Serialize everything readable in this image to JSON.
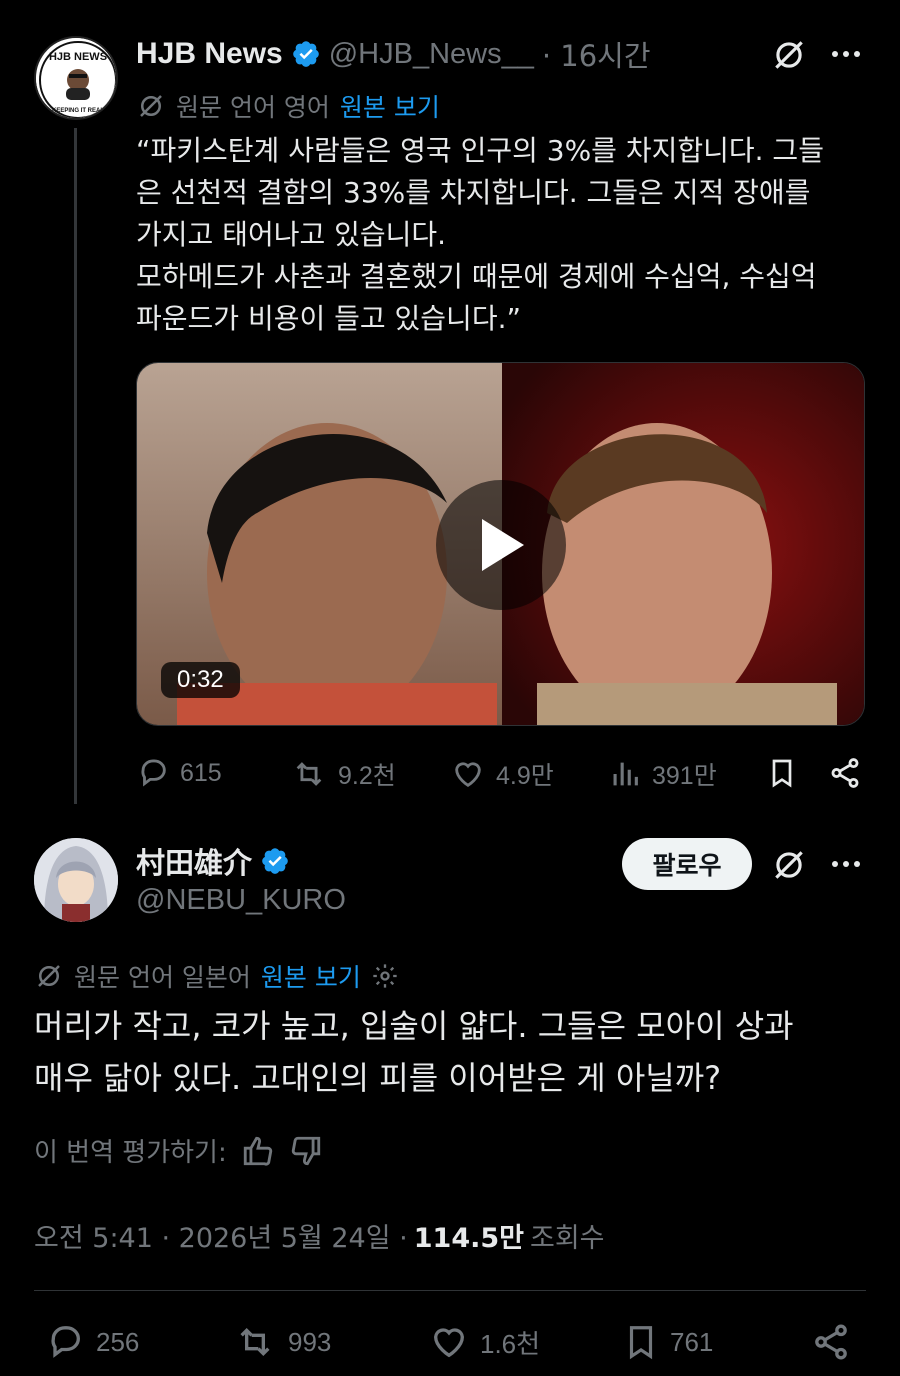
{
  "quoted": {
    "name": "HJB News",
    "handle": "@HJB_News__",
    "time": "· 16시간",
    "translate_label": "원문 언어 영어",
    "translate_link": "원본 보기",
    "text": "“파키스탄계 사람들은 영국 인구의 3%를 차지합니다. 그들\n은 선천적 결함의 33%를 차지합니다. 그들은 지적 장애를\n가지고 태어나고 있습니다.\n모하메드가 사촌과 결혼했기 때문에 경제에 수십억, 수십억\n파운드가 비용이 들고 있습니다.”",
    "video_duration": "0:32",
    "avatar_text": "HJB NEWS",
    "avatar_subtext": "KEEPING IT REAL",
    "stats": {
      "replies": "615",
      "reposts": "9.2천",
      "likes": "4.9만",
      "views": "391만"
    }
  },
  "reply": {
    "name": "村田雄介",
    "handle": "@NEBU_KURO",
    "follow_label": "팔로우",
    "translate_label": "원문 언어 일본어",
    "translate_link": "원본 보기",
    "text": "머리가 작고, 코가 높고, 입술이 얇다. 그들은 모아이 상과\n매우 닮아 있다. 고대인의 피를 이어받은 게 아닐까?",
    "rate_label": "이 번역 평가하기:",
    "timestamp": "오전 5:41 · 2026년 5월 24일 ·",
    "views_count": "114.5만",
    "views_label": "조회수",
    "stats": {
      "replies": "256",
      "reposts": "993",
      "likes": "1.6천",
      "bookmarks": "761"
    }
  },
  "colors": {
    "background": "#000000",
    "text": "#e7e9ea",
    "muted": "#71767b",
    "link": "#1d9bf0",
    "verified": "#1d9bf0"
  }
}
